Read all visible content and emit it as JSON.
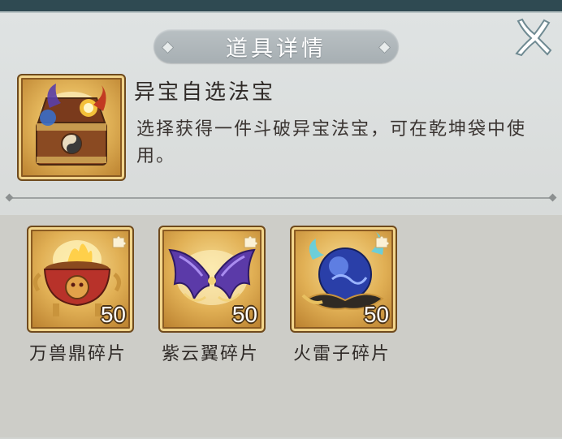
{
  "dialog": {
    "title": "道具详情"
  },
  "item": {
    "name": "异宝自选法宝",
    "description": "选择获得一件斗破异宝法宝，可在乾坤袋中使用。",
    "icon": "treasure-chest-icon"
  },
  "fragments": [
    {
      "label": "万兽鼎碎片",
      "count": "50",
      "icon": "beast-cauldron-icon"
    },
    {
      "label": "紫云翼碎片",
      "count": "50",
      "icon": "purple-wings-icon"
    },
    {
      "label": "火雷子碎片",
      "count": "50",
      "icon": "thunder-orb-icon"
    }
  ],
  "colors": {
    "panel_bg": "#d9dcdb",
    "banner": "#a7afb3",
    "gold_frame": "#e1b055",
    "text": "#2f2a27"
  }
}
